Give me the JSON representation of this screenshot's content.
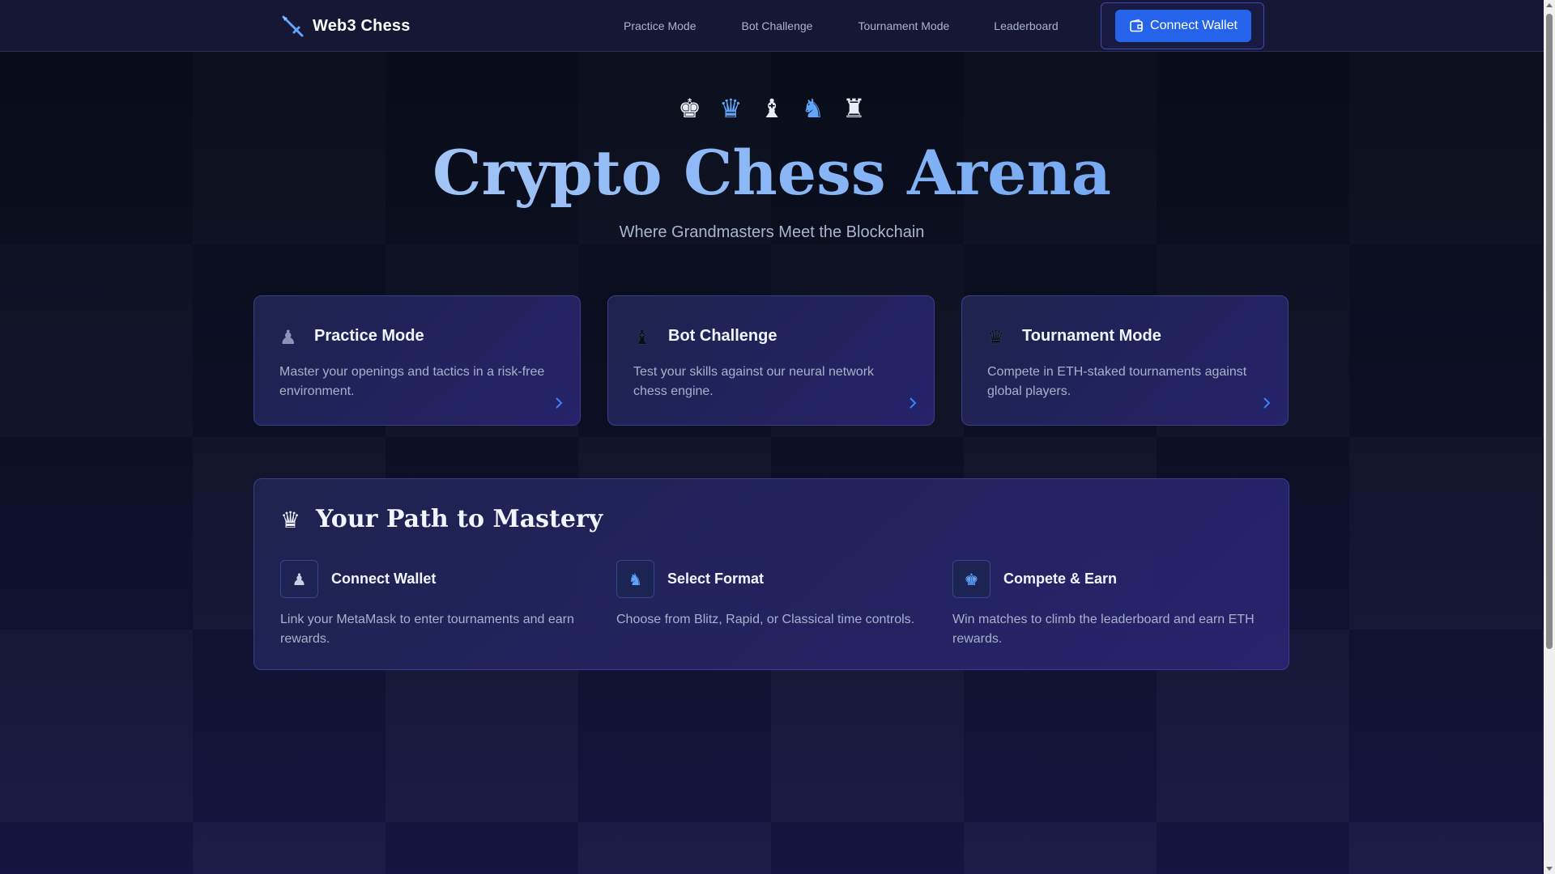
{
  "nav": {
    "brand": "Web3 Chess",
    "links": [
      "Practice Mode",
      "Bot Challenge",
      "Tournament Mode",
      "Leaderboard"
    ],
    "connect_wallet": "Connect Wallet"
  },
  "hero": {
    "pieces": [
      "♚",
      "♛",
      "♝",
      "♞",
      "♜"
    ],
    "title": "Crypto Chess Arena",
    "subtitle": "Where Grandmasters Meet the Blockchain"
  },
  "cards": [
    {
      "icon": "♟",
      "title": "Practice Mode",
      "desc": "Master your openings and tactics in a risk-free environment."
    },
    {
      "icon": "♝",
      "title": "Bot Challenge",
      "desc": "Test your skills against our neural network chess engine."
    },
    {
      "icon": "♛",
      "title": "Tournament Mode",
      "desc": "Compete in ETH-staked tournaments against global players."
    }
  ],
  "path": {
    "icon": "♛",
    "title": "Your Path to Mastery",
    "steps": [
      {
        "icon": "♟",
        "title": "Connect Wallet",
        "desc": "Link your MetaMask to enter tournaments and earn rewards."
      },
      {
        "icon": "♞",
        "title": "Select Format",
        "desc": "Choose from Blitz, Rapid, or Classical time controls."
      },
      {
        "icon": "♚",
        "title": "Compete & Earn",
        "desc": "Win matches to climb the leaderboard and earn ETH rewards."
      }
    ]
  },
  "colors": {
    "accent": "#2563eb",
    "title_gradient_start": "#c3d5f4",
    "title_gradient_end": "#5c98ec",
    "card_border": "#3a3f8a"
  }
}
